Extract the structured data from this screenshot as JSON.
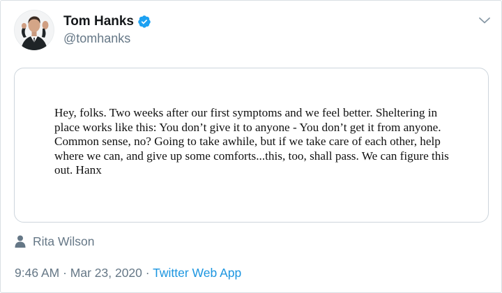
{
  "author": {
    "display_name": "Tom Hanks",
    "handle": "@tomhanks",
    "verified": true,
    "avatar_icon": "profile-photo"
  },
  "menu": {
    "icon": "chevron-down-icon"
  },
  "media": {
    "note_text": "Hey, folks. Two weeks after our first symptoms and we feel better. Sheltering in place works like this: You don’t give it to anyone - You don’t get it from anyone. Common sense, no? Going to take awhile, but if we take care of each other, help where we can, and give up some comforts...this, too, shall pass. We can figure this out.  Hanx"
  },
  "tag": {
    "icon": "person-icon",
    "name": "Rita Wilson"
  },
  "meta": {
    "time": "9:46 AM",
    "separator1": " · ",
    "date": "Mar 23, 2020",
    "separator2": " · ",
    "source": "Twitter Web App"
  },
  "colors": {
    "primary_text": "#14171a",
    "secondary_text": "#657786",
    "link": "#1b95e0",
    "verified_badge": "#1da1f2",
    "border": "#d9dfe4"
  }
}
